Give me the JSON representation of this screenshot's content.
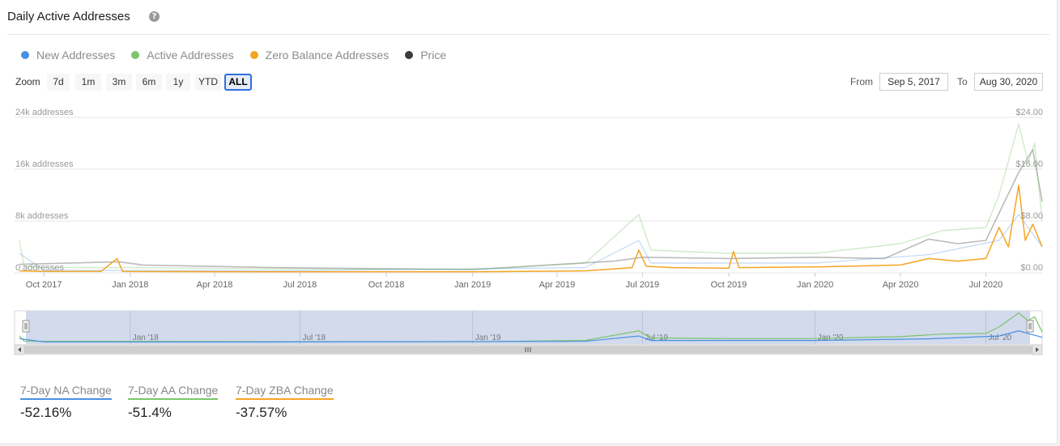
{
  "header": {
    "title": "Daily Active Addresses",
    "help_icon": "?"
  },
  "legend": [
    {
      "label": "New Addresses",
      "color": "#4a90e2"
    },
    {
      "label": "Active Addresses",
      "color": "#7cc46a"
    },
    {
      "label": "Zero Balance Addresses",
      "color": "#f5a524"
    },
    {
      "label": "Price",
      "color": "#3b3b3b"
    }
  ],
  "zoom": {
    "label": "Zoom",
    "buttons": [
      "7d",
      "1m",
      "3m",
      "6m",
      "1y",
      "YTD",
      "ALL"
    ],
    "active": "ALL"
  },
  "range": {
    "from_label": "From",
    "from_value": "Sep 5, 2017",
    "to_label": "To",
    "to_value": "Aug 30, 2020"
  },
  "stats": [
    {
      "label": "7-Day NA Change",
      "value": "-52.16%",
      "color": "#4a90e2"
    },
    {
      "label": "7-Day AA Change",
      "value": "-51.4%",
      "color": "#7cc46a"
    },
    {
      "label": "7-Day ZBA Change",
      "value": "-37.57%",
      "color": "#f5a524"
    }
  ],
  "chart_data": {
    "type": "line",
    "x_range": [
      "2017-09-05",
      "2020-08-30"
    ],
    "y_left": {
      "ticks": [
        "0 addresses",
        "8k addresses",
        "16k addresses",
        "24k addresses"
      ],
      "range": [
        0,
        24000
      ]
    },
    "y_right": {
      "ticks": [
        "$0.00",
        "$8.00",
        "$16.00",
        "$24.00"
      ],
      "range": [
        0,
        24
      ]
    },
    "x_ticks": [
      "Oct 2017",
      "Jan 2018",
      "Apr 2018",
      "Jul 2018",
      "Oct 2018",
      "Jan 2019",
      "Apr 2019",
      "Jul 2019",
      "Oct 2019",
      "Jan 2020",
      "Apr 2020",
      "Jul 2020"
    ],
    "navigator_ticks": [
      "Jan '18",
      "Jul '18",
      "Jan '19",
      "Jul '19",
      "Jan '20",
      "Jul '20"
    ],
    "series": [
      {
        "name": "Zero Balance Addresses",
        "color": "#f5a524",
        "points": [
          [
            "2017-09-05",
            300
          ],
          [
            "2017-10-01",
            200
          ],
          [
            "2017-12-01",
            200
          ],
          [
            "2017-12-18",
            2200
          ],
          [
            "2017-12-24",
            200
          ],
          [
            "2018-06-01",
            150
          ],
          [
            "2019-01-01",
            150
          ],
          [
            "2019-05-01",
            300
          ],
          [
            "2019-06-20",
            800
          ],
          [
            "2019-06-27",
            3500
          ],
          [
            "2019-07-05",
            1000
          ],
          [
            "2019-08-01",
            800
          ],
          [
            "2019-10-01",
            700
          ],
          [
            "2019-10-06",
            3300
          ],
          [
            "2019-10-12",
            800
          ],
          [
            "2020-01-01",
            900
          ],
          [
            "2020-04-01",
            1200
          ],
          [
            "2020-05-01",
            2200
          ],
          [
            "2020-06-01",
            1800
          ],
          [
            "2020-07-01",
            2200
          ],
          [
            "2020-07-15",
            7000
          ],
          [
            "2020-07-25",
            4000
          ],
          [
            "2020-08-05",
            13500
          ],
          [
            "2020-08-12",
            5000
          ],
          [
            "2020-08-20",
            7500
          ],
          [
            "2020-08-30",
            4000
          ]
        ]
      },
      {
        "name": "Active Addresses",
        "color": "#7cc46a",
        "points": [
          [
            "2017-09-05",
            5000
          ],
          [
            "2017-09-10",
            1000
          ],
          [
            "2017-10-01",
            800
          ],
          [
            "2018-01-01",
            800
          ],
          [
            "2018-06-01",
            600
          ],
          [
            "2019-01-01",
            500
          ],
          [
            "2019-05-01",
            1500
          ],
          [
            "2019-06-27",
            9000
          ],
          [
            "2019-07-10",
            3500
          ],
          [
            "2019-10-01",
            3000
          ],
          [
            "2020-01-01",
            3000
          ],
          [
            "2020-04-01",
            4500
          ],
          [
            "2020-05-15",
            6500
          ],
          [
            "2020-07-01",
            7000
          ],
          [
            "2020-07-15",
            12000
          ],
          [
            "2020-08-05",
            23000
          ],
          [
            "2020-08-15",
            17000
          ],
          [
            "2020-08-22",
            20000
          ],
          [
            "2020-08-30",
            8000
          ]
        ]
      },
      {
        "name": "New Addresses",
        "color": "#4a90e2",
        "points": [
          [
            "2017-09-05",
            3000
          ],
          [
            "2017-10-01",
            400
          ],
          [
            "2018-06-01",
            300
          ],
          [
            "2019-05-01",
            800
          ],
          [
            "2019-06-27",
            5000
          ],
          [
            "2019-07-10",
            1500
          ],
          [
            "2020-01-01",
            1500
          ],
          [
            "2020-05-01",
            2800
          ],
          [
            "2020-07-15",
            5000
          ],
          [
            "2020-08-05",
            9000
          ],
          [
            "2020-08-30",
            4000
          ]
        ]
      },
      {
        "name": "Price",
        "color": "#3b3b3b",
        "points": [
          [
            "2017-09-05",
            1.3
          ],
          [
            "2017-12-20",
            1.7
          ],
          [
            "2018-01-15",
            1.2
          ],
          [
            "2018-06-01",
            0.8
          ],
          [
            "2019-01-01",
            0.5
          ],
          [
            "2019-06-01",
            1.8
          ],
          [
            "2019-07-01",
            2.4
          ],
          [
            "2019-10-01",
            2.2
          ],
          [
            "2020-01-01",
            2.4
          ],
          [
            "2020-03-15",
            2.2
          ],
          [
            "2020-05-01",
            5.2
          ],
          [
            "2020-06-01",
            4.5
          ],
          [
            "2020-07-01",
            5.0
          ],
          [
            "2020-08-05",
            15.5
          ],
          [
            "2020-08-20",
            19.0
          ],
          [
            "2020-08-30",
            11.0
          ]
        ]
      }
    ]
  }
}
